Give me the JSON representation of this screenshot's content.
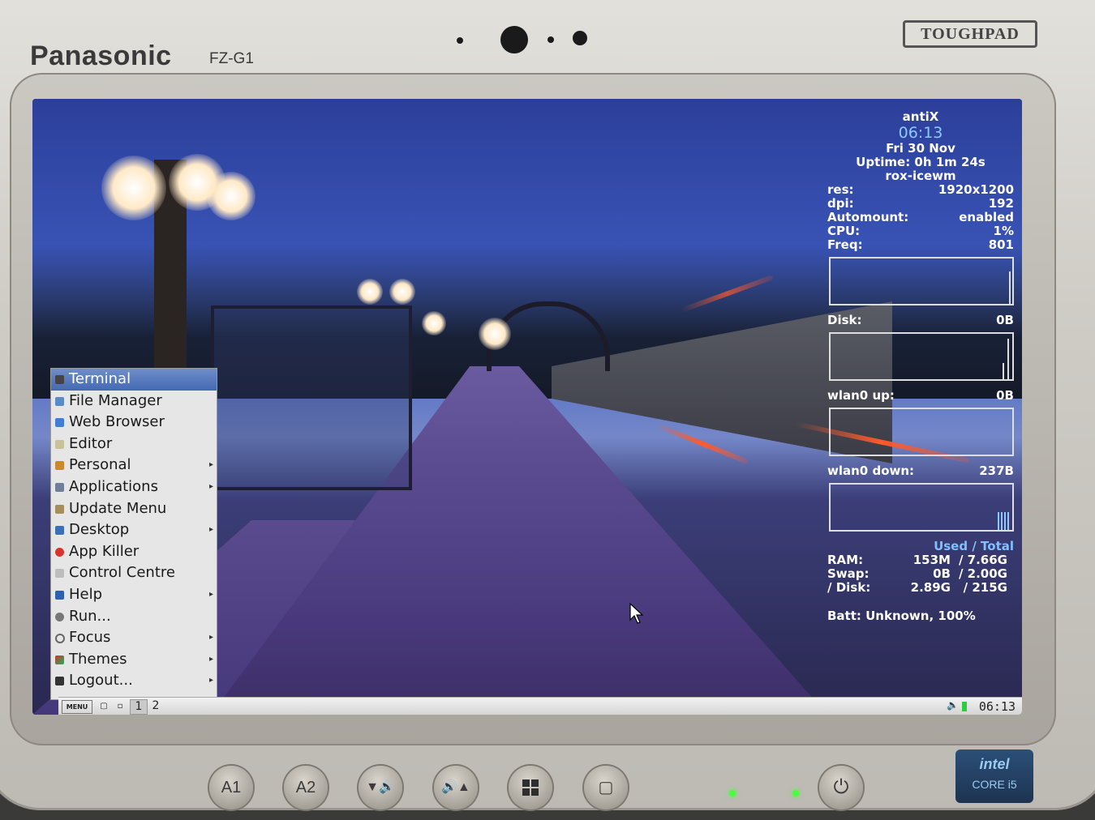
{
  "device": {
    "brand": "Panasonic",
    "model": "FZ-G1",
    "series": "TOUGHPAD",
    "buttons": [
      "A1",
      "A2"
    ],
    "chip_badge": {
      "line1": "intel",
      "line2": "CORE i5"
    }
  },
  "conky": {
    "os": "antiX",
    "time": "06:13",
    "date": "Fri 30 Nov",
    "uptime": "Uptime: 0h 1m 24s",
    "session": "rox-icewm",
    "stats": [
      {
        "label": "res:",
        "value": "1920x1200"
      },
      {
        "label": "dpi:",
        "value": "192"
      },
      {
        "label": "Automount:",
        "value": "enabled"
      },
      {
        "label": "CPU:",
        "value": "1%"
      },
      {
        "label": "Freq:",
        "value": "801"
      }
    ],
    "disk": {
      "label": "Disk:",
      "value": "0B"
    },
    "wlan_up": {
      "label": "wlan0 up:",
      "value": "0B"
    },
    "wlan_down": {
      "label": "wlan0 down:",
      "value": "237B"
    },
    "mem_header": "Used / Total",
    "mem_rows": [
      {
        "label": "RAM:",
        "used": "153M",
        "total": "/ 7.66G"
      },
      {
        "label": "Swap:",
        "used": "0B",
        "total": "/ 2.00G"
      },
      {
        "label": "/ Disk:",
        "used": "2.89G",
        "total": "/ 215G"
      }
    ],
    "battery": "Batt: Unknown, 100%"
  },
  "menu": {
    "items": [
      {
        "label": "Terminal",
        "icon": "terminal-icon",
        "color": "#444444",
        "submenu": false,
        "selected": true
      },
      {
        "label": "File Manager",
        "icon": "file-manager-icon",
        "color": "#5a8ac8",
        "submenu": false,
        "selected": false
      },
      {
        "label": "Web Browser",
        "icon": "web-browser-icon",
        "color": "#3f7ed1",
        "submenu": false,
        "selected": false
      },
      {
        "label": "Editor",
        "icon": "editor-icon",
        "color": "#c9c19c",
        "submenu": false,
        "selected": false
      },
      {
        "label": "Personal",
        "icon": "personal-icon",
        "color": "#c98a2e",
        "submenu": true,
        "selected": false
      },
      {
        "label": "Applications",
        "icon": "applications-icon",
        "color": "#6f7f99",
        "submenu": true,
        "selected": false
      },
      {
        "label": "Update Menu",
        "icon": "update-menu-icon",
        "color": "#a58e5c",
        "submenu": false,
        "selected": false
      },
      {
        "label": "Desktop",
        "icon": "desktop-icon",
        "color": "#3d6fb8",
        "submenu": true,
        "selected": false
      },
      {
        "label": "App Killer",
        "icon": "app-killer-icon",
        "color": "#d9342b",
        "submenu": false,
        "selected": false
      },
      {
        "label": "Control Centre",
        "icon": "control-centre-icon",
        "color": "#bdbdbd",
        "submenu": false,
        "selected": false
      },
      {
        "label": "Help",
        "icon": "help-icon",
        "color": "#2f5fb0",
        "submenu": true,
        "selected": false
      },
      {
        "label": "Run...",
        "icon": "run-icon",
        "color": "#777777",
        "submenu": false,
        "selected": false
      },
      {
        "label": "Focus",
        "icon": "focus-icon",
        "color": "#666666",
        "submenu": true,
        "selected": false
      },
      {
        "label": "Themes",
        "icon": "themes-icon",
        "color": "#c0392b",
        "submenu": true,
        "selected": false
      },
      {
        "label": "Logout...",
        "icon": "logout-icon",
        "color": "#333333",
        "submenu": true,
        "selected": false
      }
    ]
  },
  "taskbar": {
    "menu_label": "MENU",
    "workspaces": [
      "1",
      "2"
    ],
    "clock": "06:13"
  }
}
